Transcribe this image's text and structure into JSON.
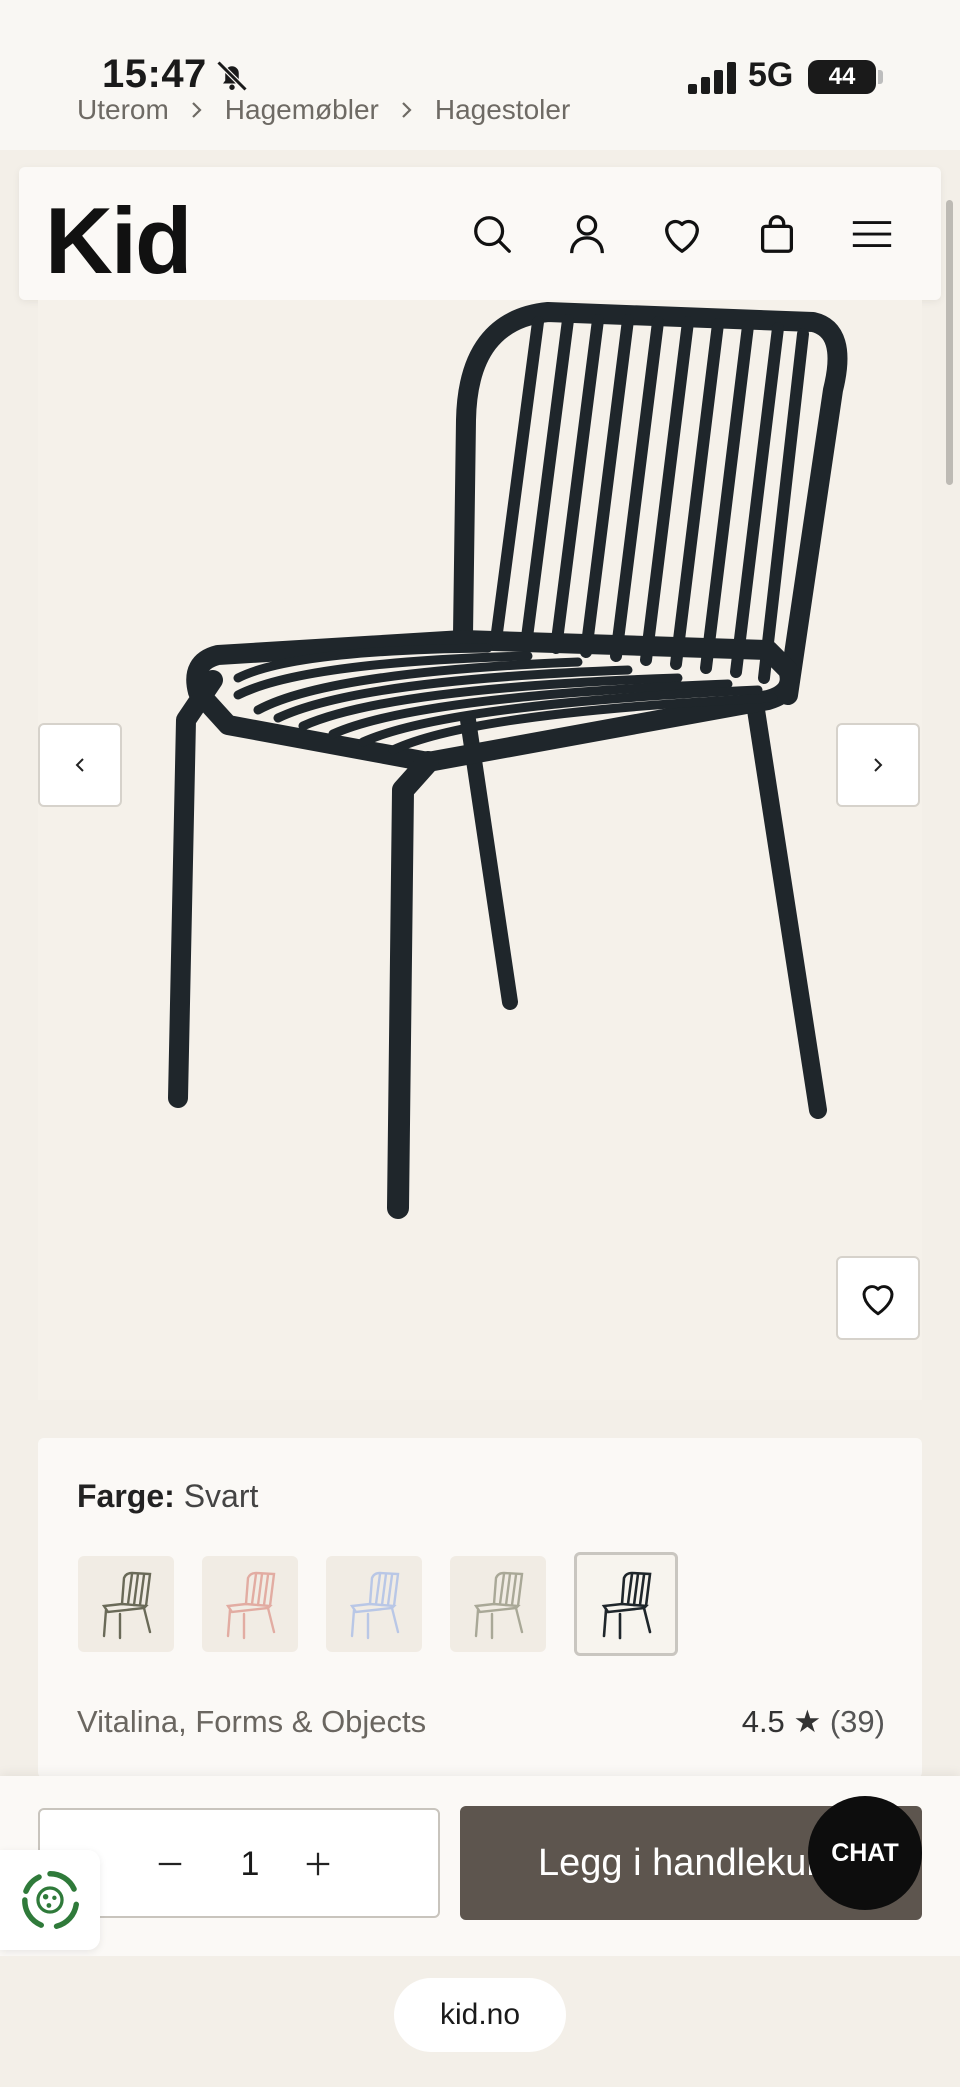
{
  "status_bar": {
    "time": "15:47",
    "network": "5G",
    "battery": "44"
  },
  "breadcrumb": {
    "items": [
      "Uterom",
      "Hagemøbler",
      "Hagestoler"
    ]
  },
  "header": {
    "logo": "Kid",
    "icons": [
      "search-icon",
      "account-icon",
      "wishlist-icon",
      "cart-icon",
      "menu-icon"
    ]
  },
  "product": {
    "color_label": "Farge:",
    "color_value": "Svart",
    "swatches": [
      "Grønn",
      "Rosa",
      "Blå",
      "Beige",
      "Svart"
    ],
    "selected_swatch": 4,
    "name": "Vitalina, Forms & Objects",
    "rating": "4.5",
    "rating_count": "(39)"
  },
  "cart": {
    "quantity": "1",
    "add_label": "Legg i handlekurv"
  },
  "chat": {
    "label": "CHAT"
  },
  "browser": {
    "url": "kid.no"
  },
  "colors": {
    "accent_button": "#5d554e",
    "background": "#f3efe8",
    "chat": "#0d0d0d"
  }
}
